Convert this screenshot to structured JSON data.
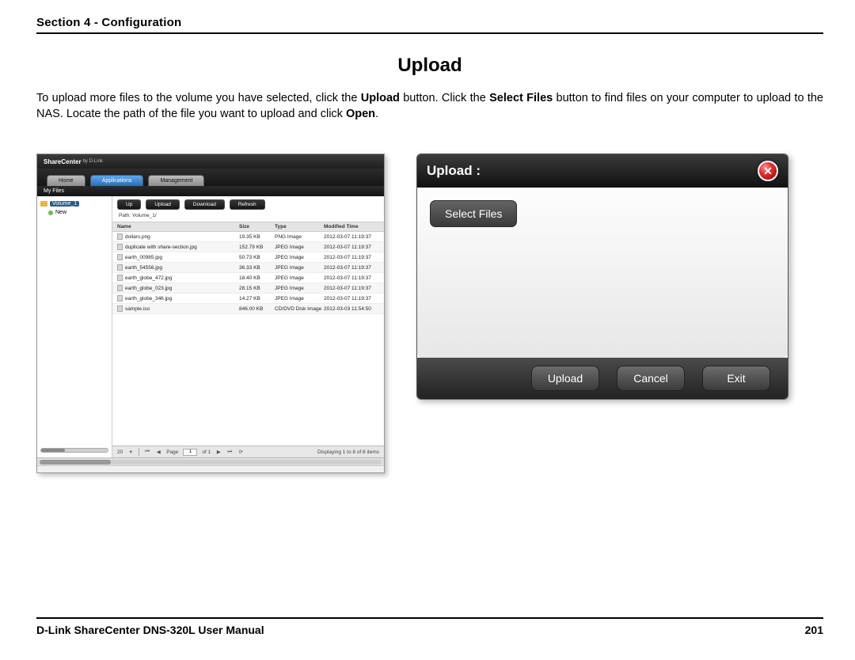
{
  "header": {
    "section": "Section 4 - Configuration"
  },
  "title": "Upload",
  "body": {
    "pre1": "To upload more files to the volume you have selected, click the ",
    "b1": "Upload",
    "mid1": " button. Click the ",
    "b2": "Select Files",
    "mid2": " button to find files on your computer to upload to the NAS. Locate the path of the file you want to upload and click ",
    "b3": "Open",
    "end": "."
  },
  "sc": {
    "brand": "ShareCenter",
    "brand_sub": "by D-Link",
    "tabs": {
      "home": "Home",
      "apps": "Applications",
      "mgmt": "Management"
    },
    "subbar": "My Files",
    "tree": {
      "root": "Volume_1",
      "child": "New"
    },
    "toolbar": {
      "up": "Up",
      "upload": "Upload",
      "download": "Download",
      "refresh": "Refresh"
    },
    "path_label": "Path:",
    "path_value": "Volume_1/",
    "cols": {
      "name": "Name",
      "size": "Size",
      "type": "Type",
      "mtime": "Modified Time"
    },
    "rows": [
      {
        "name": "dollars.png",
        "size": "19.35 KB",
        "type": "PNG Image",
        "mtime": "2012-03-07 11:19:37"
      },
      {
        "name": "duplicate with share-section.jpg",
        "size": "152.79 KB",
        "type": "JPEG Image",
        "mtime": "2012-03-07 11:19:37"
      },
      {
        "name": "earth_00985.jpg",
        "size": "50.73 KB",
        "type": "JPEG Image",
        "mtime": "2012-03-07 11:19:37"
      },
      {
        "name": "earth_54556.jpg",
        "size": "36.33 KB",
        "type": "JPEG Image",
        "mtime": "2012-03-07 11:19:37"
      },
      {
        "name": "earth_globe_472.jpg",
        "size": "18.40 KB",
        "type": "JPEG Image",
        "mtime": "2012-03-07 11:19:37"
      },
      {
        "name": "earth_globe_023.jpg",
        "size": "28.15 KB",
        "type": "JPEG Image",
        "mtime": "2012-03-07 11:19:37"
      },
      {
        "name": "earth_globe_346.jpg",
        "size": "14.27 KB",
        "type": "JPEG Image",
        "mtime": "2012-03-07 11:19:37"
      },
      {
        "name": "sample.iso",
        "size": "846.00 KB",
        "type": "CD/DVD Disk Image",
        "mtime": "2012-03-03 11:54:50"
      }
    ],
    "pager": {
      "page_size": "20",
      "page_lbl": "Page",
      "page_val": "1",
      "of": "of 1",
      "summary": "Displaying 1 to 8 of 8 items"
    }
  },
  "dlg": {
    "title": "Upload :",
    "select": "Select Files",
    "upload": "Upload",
    "cancel": "Cancel",
    "exit": "Exit"
  },
  "footer": {
    "manual": "D-Link ShareCenter DNS-320L User Manual",
    "page": "201"
  }
}
